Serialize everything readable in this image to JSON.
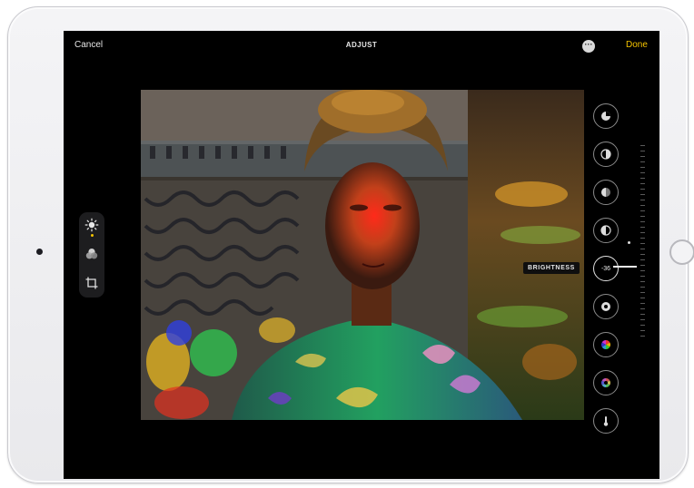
{
  "header": {
    "cancel_label": "Cancel",
    "title": "ADJUST",
    "more_label": "···",
    "done_label": "Done"
  },
  "tools": [
    {
      "name": "light-adjust-icon",
      "active": true
    },
    {
      "name": "filters-icon",
      "active": false
    },
    {
      "name": "crop-icon",
      "active": false
    }
  ],
  "adjustments": {
    "items": [
      "auto",
      "exposure",
      "brilliance",
      "highlights",
      "brightness",
      "black-point",
      "saturation",
      "vibrance",
      "warmth"
    ],
    "selected_label": "BRIGHTNESS",
    "selected_value": "-36"
  },
  "colors": {
    "accent": "#f5c400",
    "screen": "#000000",
    "device": "#eeeeF0"
  }
}
